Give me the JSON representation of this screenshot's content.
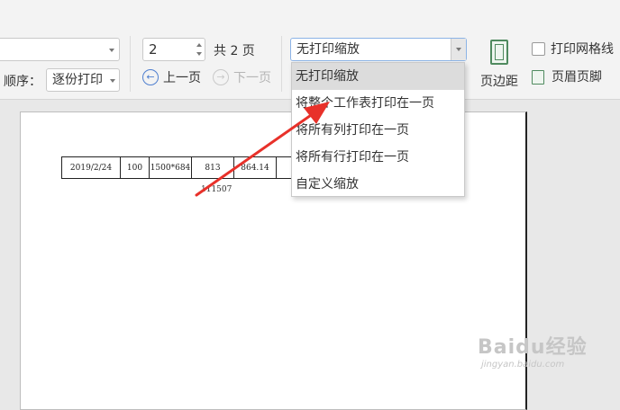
{
  "toolbar": {
    "print_order_label": "顺序：",
    "print_order_value": "逐份打印",
    "page_number_value": "2",
    "total_pages_label": "共 2 页",
    "prev_page_label": "上一页",
    "next_page_label": "下一页",
    "scaling_value": "无打印缩放",
    "margins_label": "页边距",
    "print_gridlines_label": "打印网格线",
    "header_footer_label": "页眉页脚"
  },
  "scaling_menu": {
    "items": [
      {
        "label": "无打印缩放",
        "selected": true
      },
      {
        "label": "将整个工作表打印在一页",
        "selected": false
      },
      {
        "label": "将所有列打印在一页",
        "selected": false
      },
      {
        "label": "将所有行打印在一页",
        "selected": false
      },
      {
        "label": "自定义缩放",
        "selected": false
      }
    ]
  },
  "preview": {
    "row": [
      "2019/2/24",
      "100",
      "1500*684",
      "813",
      "864.14"
    ],
    "sub_value": "111507"
  },
  "watermark": {
    "brand": "Baidu经验",
    "url": "jingyan.baidu.com"
  },
  "colors": {
    "annotation_arrow": "#e8312a",
    "accent": "#4f7fcf",
    "icon_green": "#4f8a5f"
  }
}
